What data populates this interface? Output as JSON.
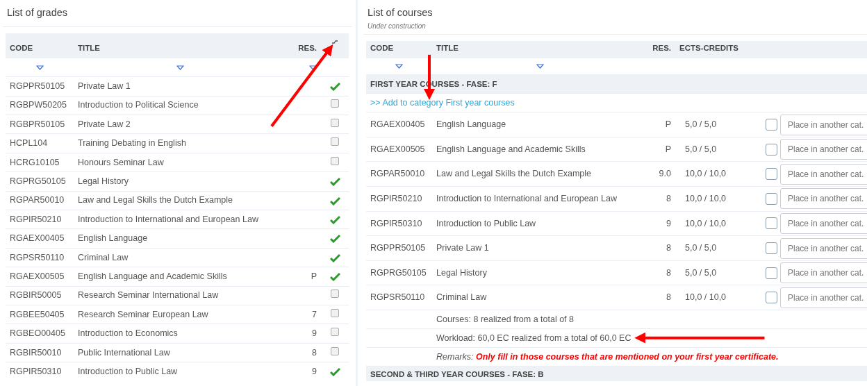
{
  "grades": {
    "title": "List of grades",
    "columns": [
      {
        "label": "CODE",
        "filterable": true
      },
      {
        "label": "TITLE",
        "filterable": true
      },
      {
        "label": "RES.",
        "filterable": true
      }
    ],
    "check_header_arrow": true,
    "rows": [
      {
        "code": "RGPPR50105",
        "title": "Private Law 1",
        "checked": true
      },
      {
        "code": "RGBPW50205",
        "title": "Introduction to Political Science",
        "checked": false
      },
      {
        "code": "RGBPR50105",
        "title": "Private Law 2",
        "checked": false
      },
      {
        "code": "HCPL104",
        "title": "Training Debating in English",
        "checked": false
      },
      {
        "code": "HCRG10105",
        "title": "Honours Seminar Law",
        "checked": false
      },
      {
        "code": "RGPRG50105",
        "title": "Legal History",
        "checked": true
      },
      {
        "code": "RGPAR50010",
        "title": "Law and Legal Skills the Dutch Example",
        "checked": true
      },
      {
        "code": "RGPIR50210",
        "title": "Introduction to International and European Law",
        "checked": true
      },
      {
        "code": "RGAEX00405",
        "title": "English Language",
        "checked": true
      },
      {
        "code": "RGPSR50110",
        "title": "Criminal Law",
        "checked": true
      },
      {
        "code": "RGAEX00505",
        "title": "English Language and Academic Skills",
        "res": "P",
        "checked": true
      },
      {
        "code": "RGBIR50005",
        "title": "Research Seminar International Law",
        "checked": false
      },
      {
        "code": "RGBEE50405",
        "title": "Research Seminar European Law",
        "res": "7",
        "checked": false
      },
      {
        "code": "RGBEO00405",
        "title": "Introduction to Economics",
        "res": "9",
        "checked": false
      },
      {
        "code": "RGBIR50010",
        "title": "Public International Law",
        "res": "8",
        "checked": false
      },
      {
        "code": "RGPIR50310",
        "title": "Introduction to Public Law",
        "res": "9",
        "checked": true
      }
    ]
  },
  "courses": {
    "title": "List of courses",
    "subtitle": "Under construction",
    "columns": [
      {
        "label": "CODE",
        "filterable": true
      },
      {
        "label": "TITLE",
        "filterable": true
      },
      {
        "label": "RES.",
        "filterable": false
      },
      {
        "label": "ECTS-CREDITS",
        "filterable": false
      }
    ],
    "categories": [
      {
        "label": "FIRST YEAR COURSES - FASE: F",
        "add_link": {
          "text": ">> Add to category First year courses",
          "arrow": true
        },
        "rows": [
          {
            "code": "RGAEX00405",
            "title": "English Language",
            "res": "P",
            "credits": "5,0 / 5,0",
            "checked": false,
            "placeholder": "Place in another cat."
          },
          {
            "code": "RGAEX00505",
            "title": "English Language and Academic Skills",
            "res": "P",
            "credits": "5,0 / 5,0",
            "checked": false,
            "placeholder": "Place in another cat."
          },
          {
            "code": "RGPAR50010",
            "title": "Law and Legal Skills the Dutch Example",
            "res": "9.0",
            "credits": "10,0 / 10,0",
            "checked": false,
            "placeholder": "Place in another cat."
          },
          {
            "code": "RGPIR50210",
            "title": "Introduction to International and European Law",
            "res": "8",
            "credits": "10,0 / 10,0",
            "checked": false,
            "placeholder": "Place in another cat."
          },
          {
            "code": "RGPIR50310",
            "title": "Introduction to Public Law",
            "res": "9",
            "credits": "10,0 / 10,0",
            "checked": false,
            "placeholder": "Place in another cat."
          },
          {
            "code": "RGPPR50105",
            "title": "Private Law 1",
            "res": "8",
            "credits": "5,0 / 5,0",
            "checked": false,
            "placeholder": "Place in another cat."
          },
          {
            "code": "RGPRG50105",
            "title": "Legal History",
            "res": "8",
            "credits": "5,0 / 5,0",
            "checked": false,
            "placeholder": "Place in another cat."
          },
          {
            "code": "RGPSR50110",
            "title": "Criminal Law",
            "res": "8",
            "credits": "10,0 / 10,0",
            "checked": false,
            "placeholder": "Place in another cat."
          }
        ],
        "summary": [
          {
            "text": "Courses: 8 realized from a total of 8"
          },
          {
            "text": "Workload: 60,0 EC realized from a total of 60,0 EC",
            "arrow": true
          }
        ],
        "remarks": {
          "label": "Remarks:",
          "text": "Only fill in those courses that are mentioned on your first year certificate."
        }
      },
      {
        "label": "SECOND & THIRD YEAR COURSES - FASE: B"
      }
    ]
  }
}
